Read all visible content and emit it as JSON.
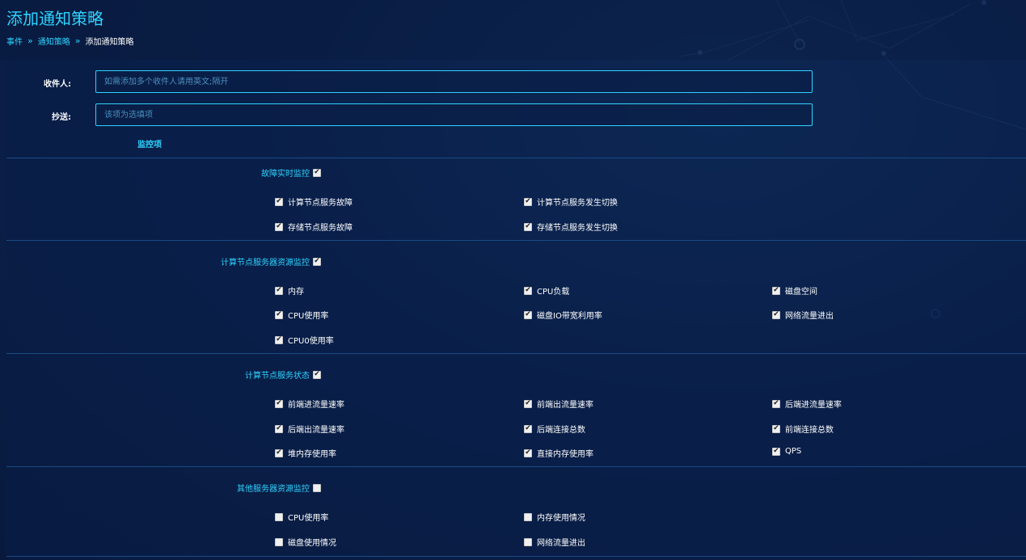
{
  "page": {
    "title": "添加通知策略",
    "breadcrumb": [
      "事件",
      "通知策略",
      "添加通知策略"
    ]
  },
  "form": {
    "recipient_label": "收件人:",
    "recipient_placeholder": "如需添加多个收件人请用英文;隔开",
    "cc_label": "抄送:",
    "cc_placeholder": "该项为选填项",
    "monitor_title": "监控项"
  },
  "groups": [
    {
      "title": "故障实时监控",
      "checked": true,
      "items": [
        {
          "label": "计算节点服务故障",
          "checked": true
        },
        {
          "label": "计算节点服务发生切换",
          "checked": true
        },
        {
          "label": "存储节点服务故障",
          "checked": true
        },
        {
          "label": "存储节点服务发生切换",
          "checked": true
        }
      ]
    },
    {
      "title": "计算节点服务器资源监控",
      "checked": true,
      "items": [
        {
          "label": "内存",
          "checked": true
        },
        {
          "label": "CPU负载",
          "checked": true
        },
        {
          "label": "磁盘空间",
          "checked": true
        },
        {
          "label": "CPU使用率",
          "checked": true
        },
        {
          "label": "磁盘IO带宽利用率",
          "checked": true
        },
        {
          "label": "网络流量进出",
          "checked": true
        },
        {
          "label": "CPU0使用率",
          "checked": true
        }
      ]
    },
    {
      "title": "计算节点服务状态",
      "checked": true,
      "items": [
        {
          "label": "前端进流量速率",
          "checked": true
        },
        {
          "label": "前端出流量速率",
          "checked": true
        },
        {
          "label": "后端进流量速率",
          "checked": true
        },
        {
          "label": "后端出流量速率",
          "checked": true
        },
        {
          "label": "后端连接总数",
          "checked": true
        },
        {
          "label": "前端连接总数",
          "checked": true
        },
        {
          "label": "堆内存使用率",
          "checked": true
        },
        {
          "label": "直接内存使用率",
          "checked": true
        },
        {
          "label": "QPS",
          "checked": true
        }
      ]
    },
    {
      "title": "其他服务器资源监控",
      "checked": false,
      "items": [
        {
          "label": "CPU使用率",
          "checked": false
        },
        {
          "label": "内存使用情况",
          "checked": false
        },
        {
          "label": "磁盘使用情况",
          "checked": false
        },
        {
          "label": "网络流量进出",
          "checked": false
        }
      ]
    }
  ],
  "colors": {
    "accent": "#2ed3ff",
    "background": "#0b2350",
    "divider": "#1a4a86"
  }
}
